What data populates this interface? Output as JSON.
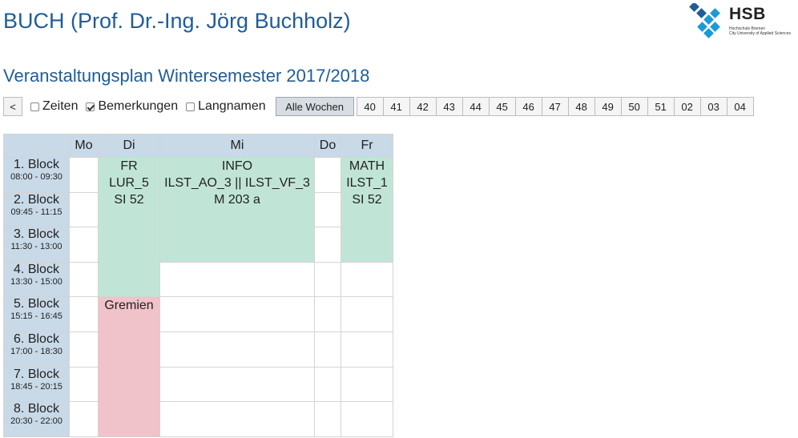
{
  "header": {
    "title": "BUCH (Prof. Dr.-Ing. Jörg Buchholz)",
    "subtitle": "Veranstaltungsplan Wintersemester 2017/2018",
    "logo_text": "HSB",
    "logo_sub_1": "Hochschule Bremen",
    "logo_sub_2": "City University of Applied Sciences",
    "colors": {
      "title": "#1f5d99",
      "logo_blue": "#1a9ad6",
      "logo_dark": "#1f5d99"
    }
  },
  "toolbar": {
    "back_label": "<",
    "checkboxes": [
      {
        "label": "Zeiten",
        "checked": false
      },
      {
        "label": "Bemerkungen",
        "checked": true
      },
      {
        "label": "Langnamen",
        "checked": false
      }
    ],
    "all_weeks_label": "Alle Wochen",
    "weeks": [
      "40",
      "41",
      "42",
      "43",
      "44",
      "45",
      "46",
      "47",
      "48",
      "49",
      "50",
      "51",
      "02",
      "03",
      "04"
    ]
  },
  "schedule": {
    "days": [
      "Mo",
      "Di",
      "Mi",
      "Do",
      "Fr"
    ],
    "blocks": [
      {
        "name": "1. Block",
        "time": "08:00 - 09:30"
      },
      {
        "name": "2. Block",
        "time": "09:45 - 11:15"
      },
      {
        "name": "3. Block",
        "time": "11:30 - 13:00"
      },
      {
        "name": "4. Block",
        "time": "13:30 - 15:00"
      },
      {
        "name": "5. Block",
        "time": "15:15 - 16:45"
      },
      {
        "name": "6. Block",
        "time": "17:00 - 18:30"
      },
      {
        "name": "7. Block",
        "time": "18:45 - 20:15"
      },
      {
        "name": "8. Block",
        "time": "20:30 - 22:00"
      }
    ],
    "events": {
      "di_fr": {
        "lines": [
          "FR",
          "LUR_5",
          "SI 52"
        ],
        "color": "#c0e5d6"
      },
      "mi_info": {
        "lines": [
          "INFO",
          "ILST_AO_3 || ILST_VF_3",
          "M 203 a"
        ],
        "color": "#c0e5d6"
      },
      "fr_math": {
        "lines": [
          "MATH",
          "ILST_1",
          "SI 52"
        ],
        "color": "#c0e5d6"
      },
      "di_gremien": {
        "lines": [
          "Gremien"
        ],
        "color": "#f0c2c9"
      }
    },
    "colors": {
      "header_bg": "#c8d9e8",
      "lecture_bg": "#c0e5d6",
      "committee_bg": "#f0c2c9"
    }
  }
}
